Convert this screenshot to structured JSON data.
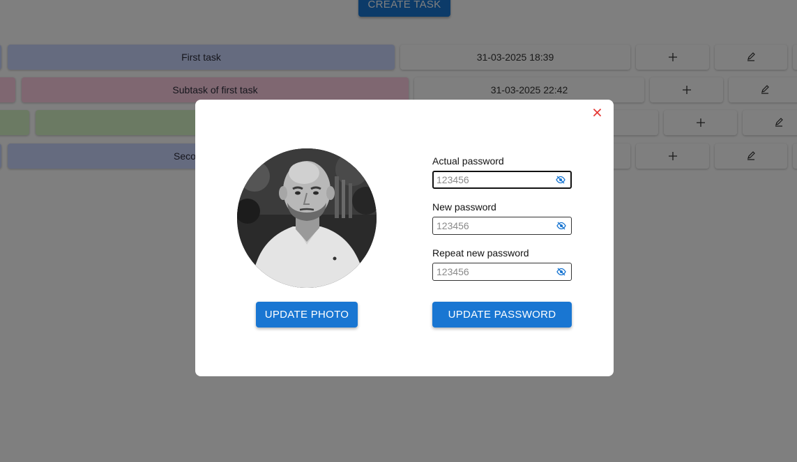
{
  "background": {
    "create_task_label": "CREATE TASK",
    "tasks": [
      {
        "title": "First task",
        "date": "31-03-2025 18:39",
        "color": "#cbd7ff"
      },
      {
        "title": "Subtask of first task",
        "date": "31-03-2025 22:42",
        "color": "#ffcfe2"
      },
      {
        "title": "",
        "date": "",
        "color": "#d7f5c6"
      },
      {
        "title": "Seco",
        "date": "",
        "color": "#cbd7ff"
      }
    ],
    "add_icon": "plus-icon",
    "edit_icon": "pencil-icon"
  },
  "modal": {
    "close_icon": "close-icon",
    "close_color": "#e53935",
    "update_photo_label": "UPDATE PHOTO",
    "update_password_label": "UPDATE PASSWORD",
    "fields": {
      "actual": {
        "label": "Actual password",
        "placeholder": "123456"
      },
      "new": {
        "label": "New password",
        "placeholder": "123456"
      },
      "repeat": {
        "label": "Repeat new password",
        "placeholder": "123456"
      }
    },
    "visibility_icon": "eye-off-icon",
    "accent": "#1976d2"
  }
}
